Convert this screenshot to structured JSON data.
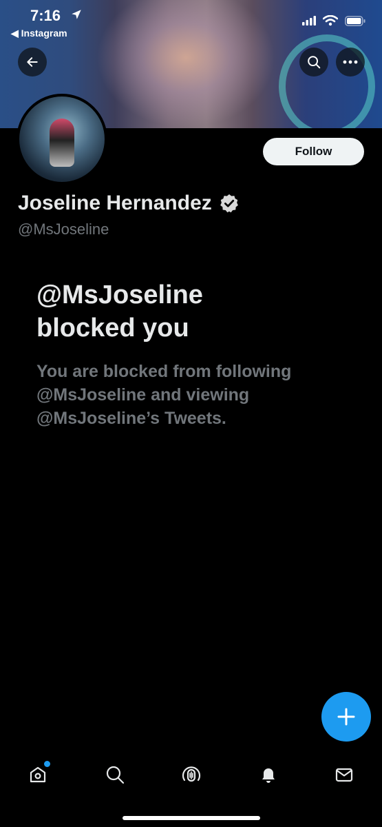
{
  "statusbar": {
    "time": "7:16",
    "back_app": "Instagram"
  },
  "profile": {
    "name": "Joseline Hernandez",
    "handle": "@MsJoseline",
    "follow_label": "Follow",
    "verified_icon": "verified-badge-icon"
  },
  "blocked": {
    "title_line1": "@MsJoseline",
    "title_line2": "blocked you",
    "desc_line1": "You are blocked from following",
    "desc_line2": "@MsJoseline and viewing",
    "desc_line3": "@MsJoseline’s Tweets."
  },
  "tabs": [
    {
      "name": "home",
      "icon": "home-icon",
      "has_notification_dot": true
    },
    {
      "name": "search",
      "icon": "search-icon"
    },
    {
      "name": "spaces",
      "icon": "spaces-icon"
    },
    {
      "name": "notifications",
      "icon": "bell-icon"
    },
    {
      "name": "messages",
      "icon": "mail-icon"
    }
  ],
  "colors": {
    "accent": "#1d9bf0",
    "background": "#000000",
    "primary_text": "#e7e9ea",
    "secondary_text": "#71767b",
    "follow_bg": "#eff3f4"
  }
}
